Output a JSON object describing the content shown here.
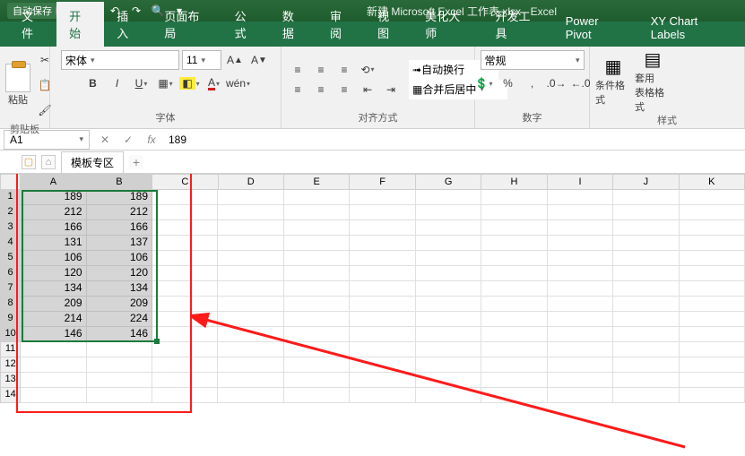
{
  "titlebar": {
    "autosave_label": "自动保存",
    "autosave_state": "关",
    "title": "新建 Microsoft Excel 工作表.xlsx  -  Excel"
  },
  "tabs": {
    "items": [
      "文件",
      "开始",
      "插入",
      "页面布局",
      "公式",
      "数据",
      "审阅",
      "视图",
      "美化大师",
      "开发工具",
      "Power Pivot",
      "XY Chart Labels"
    ],
    "active_index": 1
  },
  "ribbon": {
    "clipboard": {
      "paste": "粘贴",
      "label": "剪贴板"
    },
    "font": {
      "name": "宋体",
      "size": "11",
      "label": "字体"
    },
    "alignment": {
      "wrap": "自动换行",
      "merge": "合并后居中",
      "label": "对齐方式"
    },
    "number": {
      "format": "常规",
      "label": "数字"
    },
    "styles": {
      "cond": "条件格式",
      "table": "套用\n表格格式",
      "label": "样式"
    }
  },
  "formula_bar": {
    "name_box": "A1",
    "fx": "fx",
    "value": "189"
  },
  "sheet_tabs": {
    "template_zone": "模板专区"
  },
  "grid": {
    "columns": [
      "A",
      "B",
      "C",
      "D",
      "E",
      "F",
      "G",
      "H",
      "I",
      "J",
      "K"
    ],
    "row_count": 14,
    "selected_cols": [
      0,
      1
    ],
    "selected_rows": [
      0,
      1,
      2,
      3,
      4,
      5,
      6,
      7,
      8,
      9
    ],
    "data": [
      {
        "A": "189",
        "B": "189"
      },
      {
        "A": "212",
        "B": "212"
      },
      {
        "A": "166",
        "B": "166"
      },
      {
        "A": "131",
        "B": "137"
      },
      {
        "A": "106",
        "B": "106"
      },
      {
        "A": "120",
        "B": "120"
      },
      {
        "A": "134",
        "B": "134"
      },
      {
        "A": "209",
        "B": "209"
      },
      {
        "A": "214",
        "B": "224"
      },
      {
        "A": "146",
        "B": "146"
      }
    ]
  },
  "annotations": {
    "color": "#ff1a1a"
  }
}
